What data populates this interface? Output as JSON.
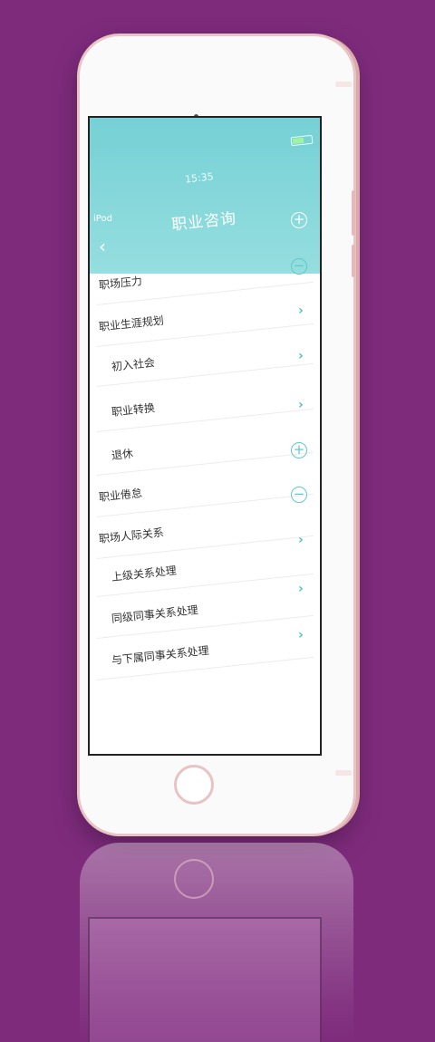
{
  "status": {
    "carrier": "iPod",
    "time": "15:35"
  },
  "header": {
    "title": "职业咨询",
    "back_icon": "‹"
  },
  "items": [
    {
      "label": "职场压力",
      "control": "minus"
    },
    {
      "label": "职业生涯规划",
      "control": "chevron"
    },
    {
      "label": "初入社会",
      "control": "chevron"
    },
    {
      "label": "职业转换",
      "control": "chevron"
    },
    {
      "label": "退休",
      "control": "plus"
    },
    {
      "label": "职业倦怠",
      "control": "minus"
    },
    {
      "label": "职场人际关系",
      "control": "chevron"
    },
    {
      "label": "上级关系处理",
      "control": "chevron"
    },
    {
      "label": "同级同事关系处理",
      "control": "chevron"
    },
    {
      "label": "与下属同事关系处理",
      "control": ""
    }
  ],
  "colors": {
    "background": "#7e2b7c",
    "accent": "#5ec9cd",
    "header": "#57c6cc"
  }
}
